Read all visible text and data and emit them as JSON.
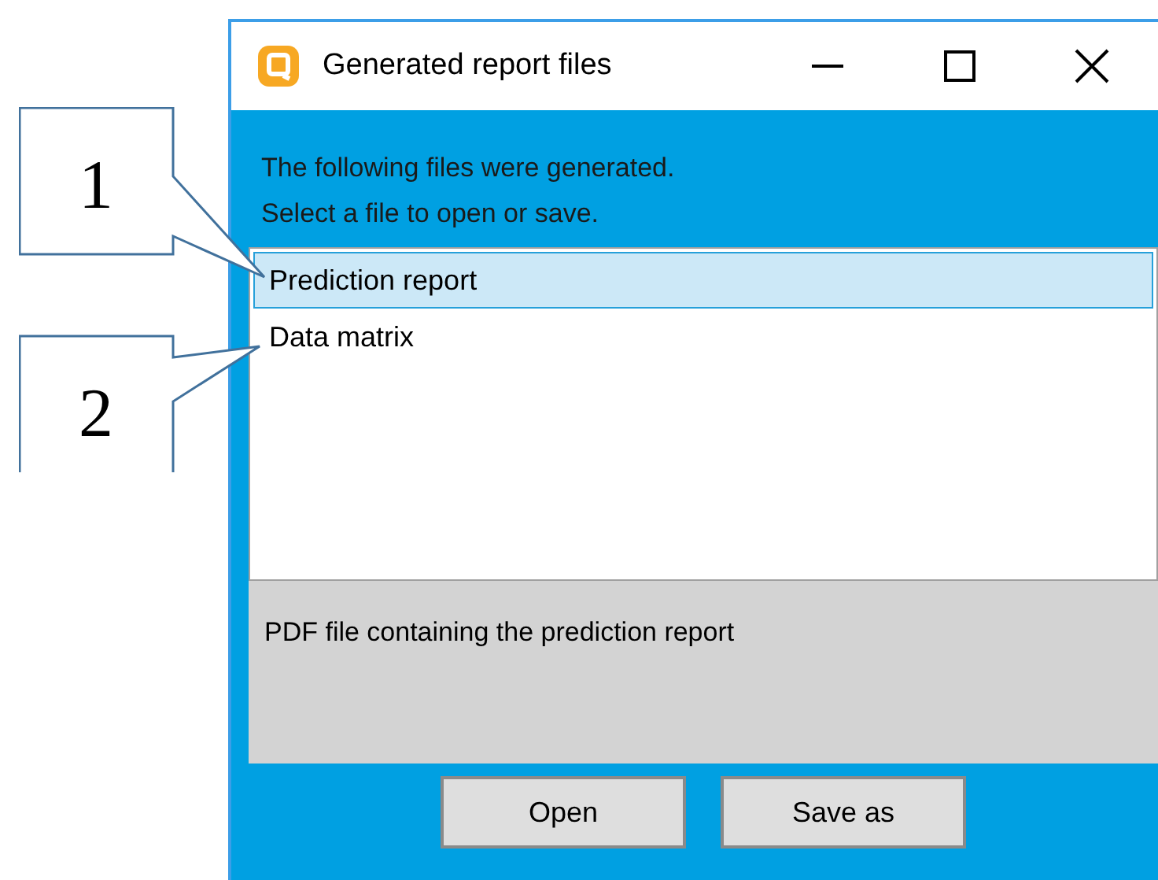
{
  "window": {
    "title": "Generated report files"
  },
  "message": [
    "The following files were generated.",
    "Select a file to open or save."
  ],
  "files": [
    {
      "name": "Prediction report",
      "selected": true
    },
    {
      "name": "Data matrix",
      "selected": false
    }
  ],
  "description": "PDF file containing the prediction report",
  "buttons": [
    "Open",
    "Save as"
  ],
  "callouts": [
    {
      "label": "1"
    },
    {
      "label": "2"
    }
  ]
}
